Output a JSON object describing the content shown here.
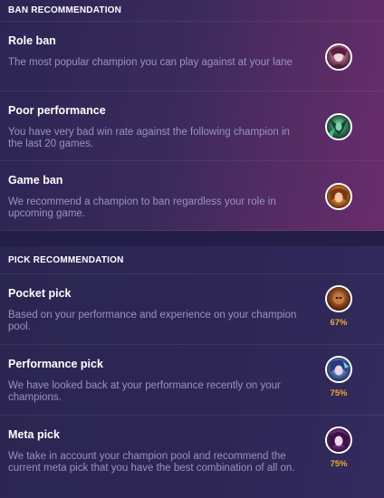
{
  "ban": {
    "header": "BAN RECOMMENDATION",
    "items": [
      {
        "title": "Role ban",
        "description": "The most popular champion you can play against at your lane",
        "icon": "champion-portrait-icon"
      },
      {
        "title": "Poor performance",
        "description": "You have very bad win rate against the following champion in the last 20 games.",
        "icon": "champion-portrait-icon"
      },
      {
        "title": "Game ban",
        "description": "We recommend a champion to ban regardless your role in upcoming game.",
        "icon": "champion-portrait-icon"
      }
    ]
  },
  "pick": {
    "header": "PICK RECOMMENDATION",
    "items": [
      {
        "title": "Pocket pick",
        "description": "Based on your performance and experience on your champion pool.",
        "percent": "67%",
        "icon": "champion-portrait-icon"
      },
      {
        "title": "Performance pick",
        "description": "We have looked back at your performance recently on your champions.",
        "percent": "75%",
        "icon": "champion-portrait-icon"
      },
      {
        "title": "Meta pick",
        "description": "We take in account your champion pool and recommend the current meta pick that you have the best combination of all on.",
        "percent": "75%",
        "icon": "champion-portrait-icon"
      }
    ]
  },
  "colors": {
    "accent_percent": "#f0a63a",
    "description_text": "#9a93be",
    "title_text": "#ffffff"
  }
}
